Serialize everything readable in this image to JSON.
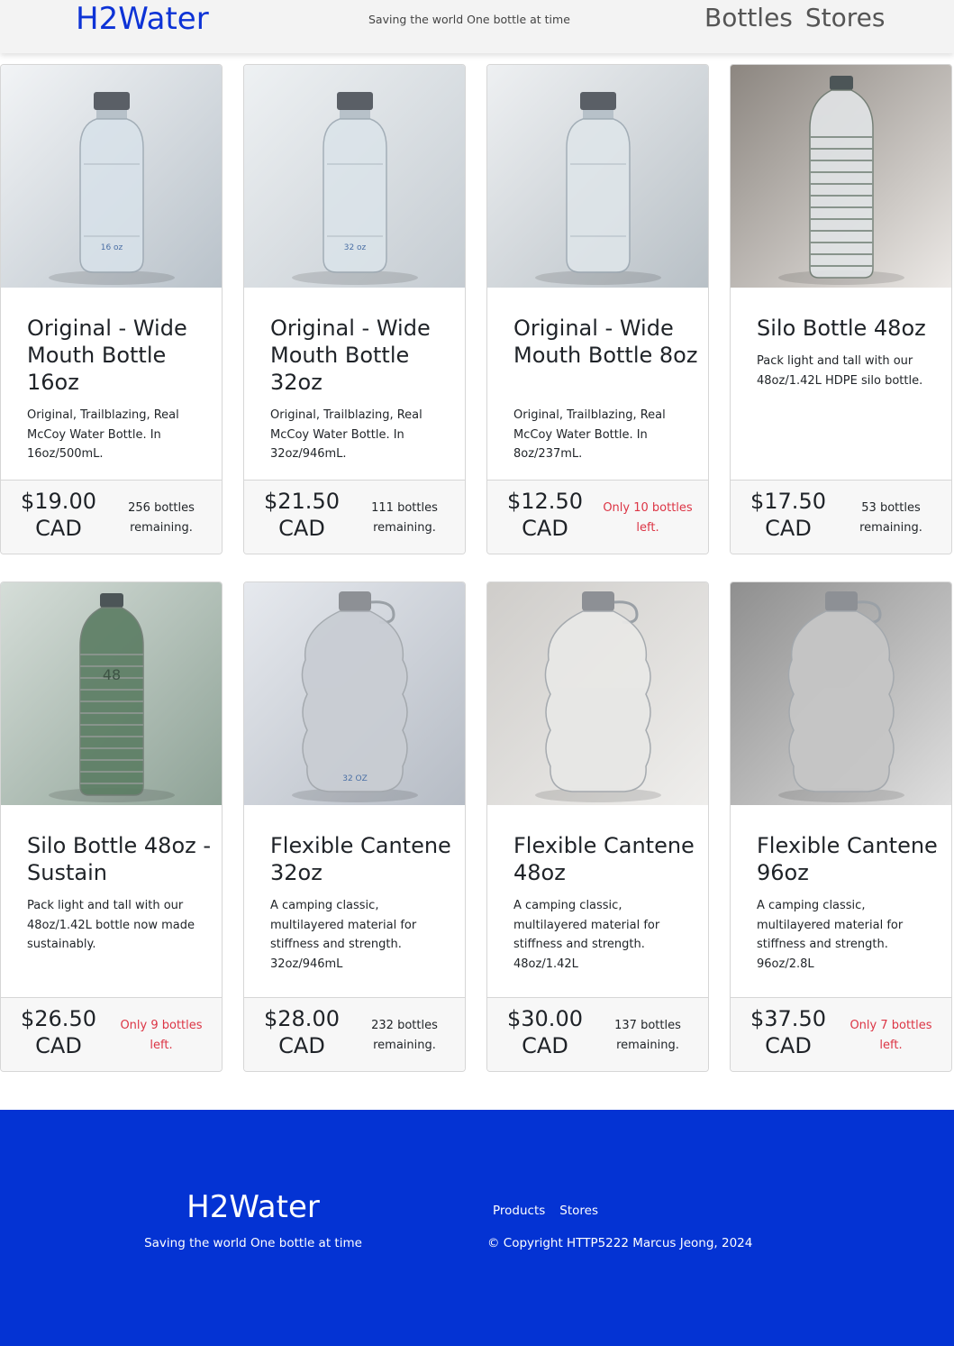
{
  "header": {
    "brand": "H2Water",
    "tagline": "Saving the world One bottle at time",
    "nav": [
      "Bottles",
      "Stores"
    ]
  },
  "products": [
    {
      "title": "Original - Wide Mouth Bottle 16oz",
      "description": "Original, Trailblazing, Real McCoy Water Bottle. In 16oz/500mL.",
      "price": "$19.00 CAD",
      "stock": "256 bottles remaining.",
      "low_stock": false,
      "image_label": "16 oz",
      "bottle_color": "#d8e2ea"
    },
    {
      "title": "Original - Wide Mouth Bottle 32oz",
      "description": "Original, Trailblazing, Real McCoy Water Bottle. In 32oz/946mL.",
      "price": "$21.50 CAD",
      "stock": "111 bottles remaining.",
      "low_stock": false,
      "image_label": "32 oz",
      "bottle_color": "#dbe4ea"
    },
    {
      "title": "Original - Wide Mouth Bottle 8oz",
      "description": "Original, Trailblazing, Real McCoy Water Bottle. In 8oz/237mL.",
      "price": "$12.50 CAD",
      "stock": "Only 10 bottles left.",
      "low_stock": true,
      "image_label": "",
      "bottle_color": "#dfe6ea"
    },
    {
      "title": "Silo Bottle 48oz",
      "description": "Pack light and tall with our 48oz/1.42L HDPE silo bottle.",
      "price": "$17.50 CAD",
      "stock": "53 bottles remaining.",
      "low_stock": false,
      "image_label": "",
      "bottle_color": "#e1e4e6"
    },
    {
      "title": "Silo Bottle 48oz - Sustain",
      "description": "Pack light and tall with our 48oz/1.42L bottle now made sustainably.",
      "price": "$26.50 CAD",
      "stock": "Only 9 bottles left.",
      "low_stock": true,
      "image_label": "48",
      "bottle_color": "#5b7d63"
    },
    {
      "title": "Flexible Cantene 32oz",
      "description": "A camping classic, multilayered material for stiffness and strength. 32oz/946mL",
      "price": "$28.00 CAD",
      "stock": "232 bottles remaining.",
      "low_stock": false,
      "image_label": "32 OZ",
      "bottle_color": "#c9cdd3"
    },
    {
      "title": "Flexible Cantene 48oz",
      "description": "A camping classic, multilayered material for stiffness and strength. 48oz/1.42L",
      "price": "$30.00 CAD",
      "stock": "137 bottles remaining.",
      "low_stock": false,
      "image_label": "",
      "bottle_color": "#e8e8e6"
    },
    {
      "title": "Flexible Cantene 96oz",
      "description": "A camping classic, multilayered material for stiffness and strength. 96oz/2.8L",
      "price": "$37.50 CAD",
      "stock": "Only 7 bottles left.",
      "low_stock": true,
      "image_label": "",
      "bottle_color": "#c6c6c6"
    }
  ],
  "footer": {
    "brand": "H2Water",
    "tagline": "Saving the world One bottle at time",
    "links": [
      "Products",
      "Stores"
    ],
    "copyright": "© Copyright HTTP5222 Marcus Jeong, 2024"
  },
  "colors": {
    "brand_blue": "#0433d3",
    "low_stock_red": "#dc3545"
  }
}
